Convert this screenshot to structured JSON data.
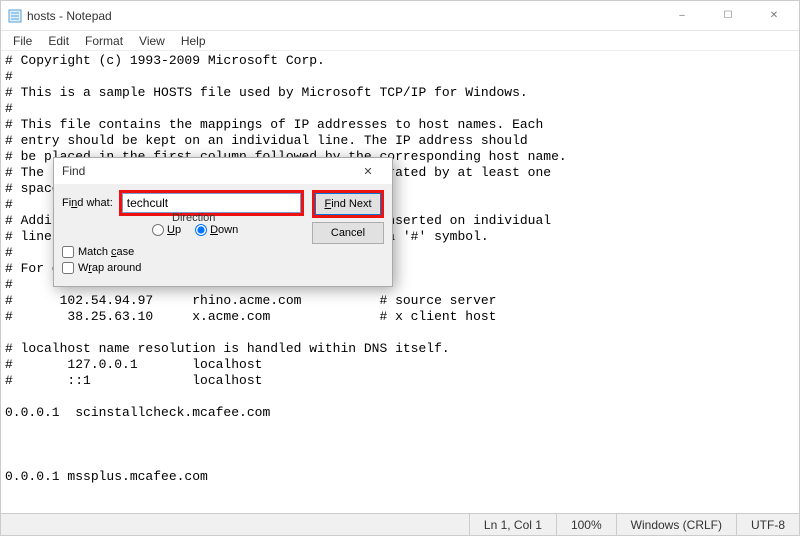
{
  "window": {
    "title": "hosts - Notepad",
    "controls": {
      "min": "–",
      "max": "☐",
      "close": "✕"
    }
  },
  "menu": {
    "file": "File",
    "edit": "Edit",
    "format": "Format",
    "view": "View",
    "help": "Help"
  },
  "editor": {
    "content": "# Copyright (c) 1993-2009 Microsoft Corp.\n#\n# This is a sample HOSTS file used by Microsoft TCP/IP for Windows.\n#\n# This file contains the mappings of IP addresses to host names. Each\n# entry should be kept on an individual line. The IP address should\n# be placed in the first column followed by the corresponding host name.\n# The IP address and the host name should be separated by at least one\n# space.\n#\n# Additionally, comments (such as these) may be inserted on individual\n# lines or following the machine name denoted by a '#' symbol.\n#\n# For example:\n#\n#      102.54.94.97     rhino.acme.com          # source server\n#       38.25.63.10     x.acme.com              # x client host\n\n# localhost name resolution is handled within DNS itself.\n#       127.0.0.1       localhost\n#       ::1             localhost\n\n0.0.0.1  scinstallcheck.mcafee.com\n\n\n\n0.0.0.1 mssplus.mcafee.com"
  },
  "find": {
    "title": "Find",
    "label": "Find what:",
    "value": "techcult",
    "direction_label": "Direction",
    "up": "Up",
    "down": "Down",
    "down_selected": true,
    "match_case": "Match case",
    "wrap_around": "Wrap around",
    "find_next": "Find Next",
    "cancel": "Cancel",
    "close": "✕"
  },
  "status": {
    "position": "Ln 1, Col 1",
    "zoom": "100%",
    "eol": "Windows (CRLF)",
    "encoding": "UTF-8"
  }
}
